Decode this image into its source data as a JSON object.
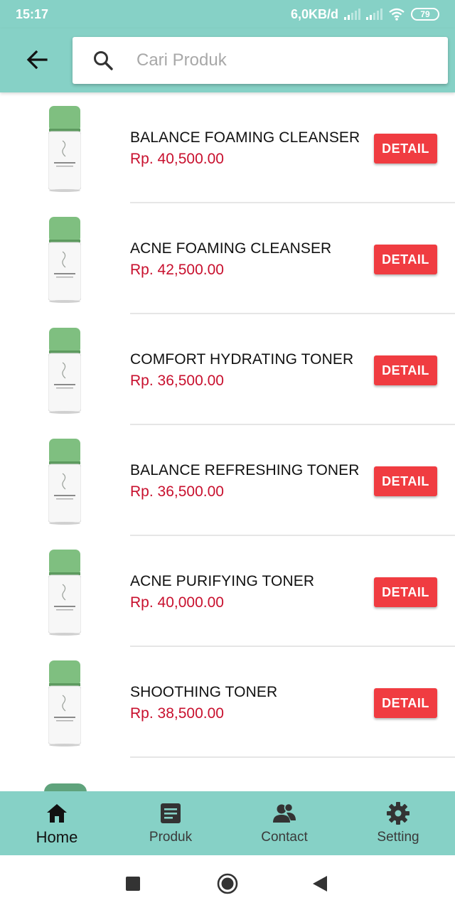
{
  "status_bar": {
    "time": "15:17",
    "net_speed": "6,0KB/d",
    "battery": "79",
    "icons": [
      "signal-icon",
      "signal-icon",
      "wifi-icon",
      "battery-icon"
    ]
  },
  "search": {
    "placeholder": "Cari Produk",
    "value": ""
  },
  "colors": {
    "primary": "#86d1c6",
    "price": "#c8102e",
    "detail_button": "#f03c41"
  },
  "products": [
    {
      "name": "BALANCE FOAMING CLEANSER",
      "price": "Rp. 40,500.00",
      "button": "DETAIL"
    },
    {
      "name": "ACNE FOAMING CLEANSER",
      "price": "Rp. 42,500.00",
      "button": "DETAIL"
    },
    {
      "name": "COMFORT HYDRATING TONER",
      "price": "Rp. 36,500.00",
      "button": "DETAIL"
    },
    {
      "name": "BALANCE REFRESHING TONER",
      "price": "Rp. 36,500.00",
      "button": "DETAIL"
    },
    {
      "name": "ACNE PURIFYING TONER",
      "price": "Rp. 40,000.00",
      "button": "DETAIL"
    },
    {
      "name": "SHOOTHING TONER",
      "price": "Rp. 38,500.00",
      "button": "DETAIL"
    }
  ],
  "bottom_nav": {
    "items": [
      {
        "label": "Home",
        "icon": "home-icon",
        "active": true
      },
      {
        "label": "Produk",
        "icon": "document-icon",
        "active": false
      },
      {
        "label": "Contact",
        "icon": "contacts-icon",
        "active": false
      },
      {
        "label": "Setting",
        "icon": "gear-icon",
        "active": false
      }
    ]
  },
  "system_nav": [
    "recents-icon",
    "home-circle-icon",
    "back-triangle-icon"
  ]
}
